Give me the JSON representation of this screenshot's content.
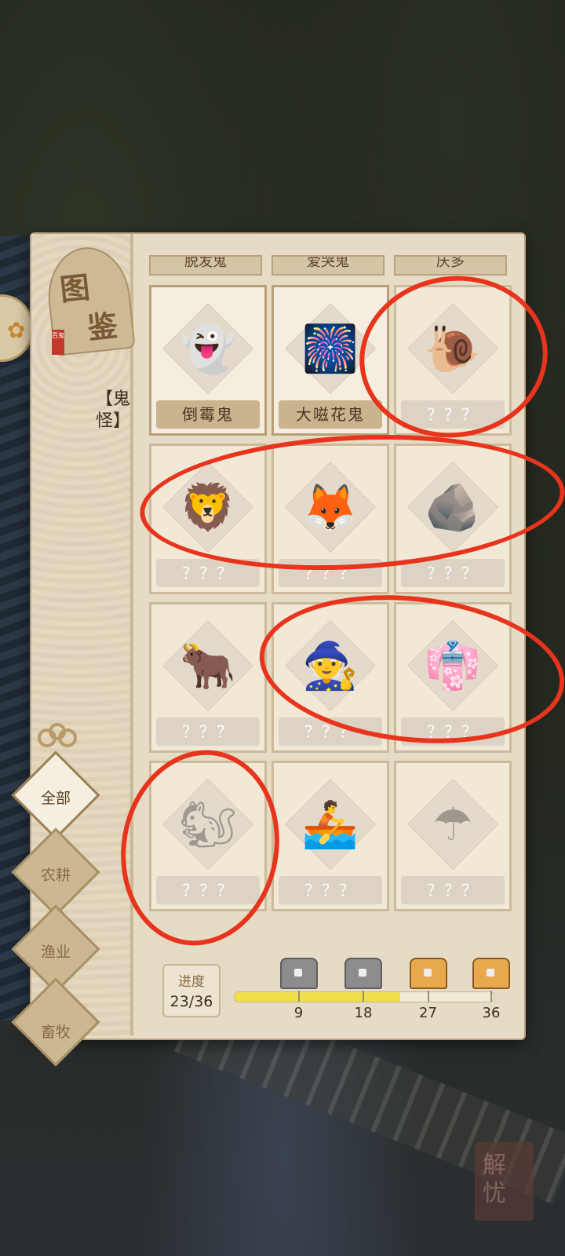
{
  "panel": {
    "title_chars": [
      "图",
      "鉴"
    ],
    "seal_text": "百鬼",
    "category_title": "【鬼怪】"
  },
  "filters": [
    {
      "label": "全部",
      "active": true
    },
    {
      "label": "农耕",
      "active": false
    },
    {
      "label": "渔业",
      "active": false
    },
    {
      "label": "畜牧",
      "active": false
    }
  ],
  "partial_row_labels": [
    "脱发鬼",
    "爱哭鬼",
    "庆多"
  ],
  "cards": [
    {
      "name": "倒霉鬼",
      "unlocked": true,
      "icon": "hunched-ghost-icon",
      "glyph": "👻"
    },
    {
      "name": "大嗞花鬼",
      "unlocked": true,
      "icon": "firework-ghost-icon",
      "glyph": "🎆"
    },
    {
      "name": "？？？",
      "unlocked": false,
      "icon": "snail-spirit-icon",
      "glyph": "🐌"
    },
    {
      "name": "？？？",
      "unlocked": false,
      "icon": "lion-mask-icon",
      "glyph": "🦁"
    },
    {
      "name": "？？？",
      "unlocked": false,
      "icon": "fox-tail-spirit-icon",
      "glyph": "🦊"
    },
    {
      "name": "？？？",
      "unlocked": false,
      "icon": "rock-spirit-icon",
      "glyph": "🪨"
    },
    {
      "name": "？？？",
      "unlocked": false,
      "icon": "ox-demon-icon",
      "glyph": "🐂"
    },
    {
      "name": "？？？",
      "unlocked": false,
      "icon": "staff-deity-icon",
      "glyph": "🧙"
    },
    {
      "name": "？？？",
      "unlocked": false,
      "icon": "maiden-spirit-icon",
      "glyph": "👘"
    },
    {
      "name": "？？？",
      "unlocked": false,
      "icon": "squirrel-icon",
      "glyph": "🐿"
    },
    {
      "name": "？？？",
      "unlocked": false,
      "icon": "boat-fish-spirit-icon",
      "glyph": "🚣"
    },
    {
      "name": "？？？",
      "unlocked": false,
      "icon": "umbrella-spirit-icon",
      "glyph": "☂"
    }
  ],
  "progress": {
    "label": "进度",
    "value_text": "23/36",
    "current": 23,
    "total": 36,
    "milestones": [
      "9",
      "18",
      "27",
      "36"
    ]
  },
  "colors": {
    "annotation_red": "#e8341c",
    "bar_fill": "#efe04a",
    "panel_bg": "#e6dbc4"
  },
  "corner_stamp": "解忧"
}
